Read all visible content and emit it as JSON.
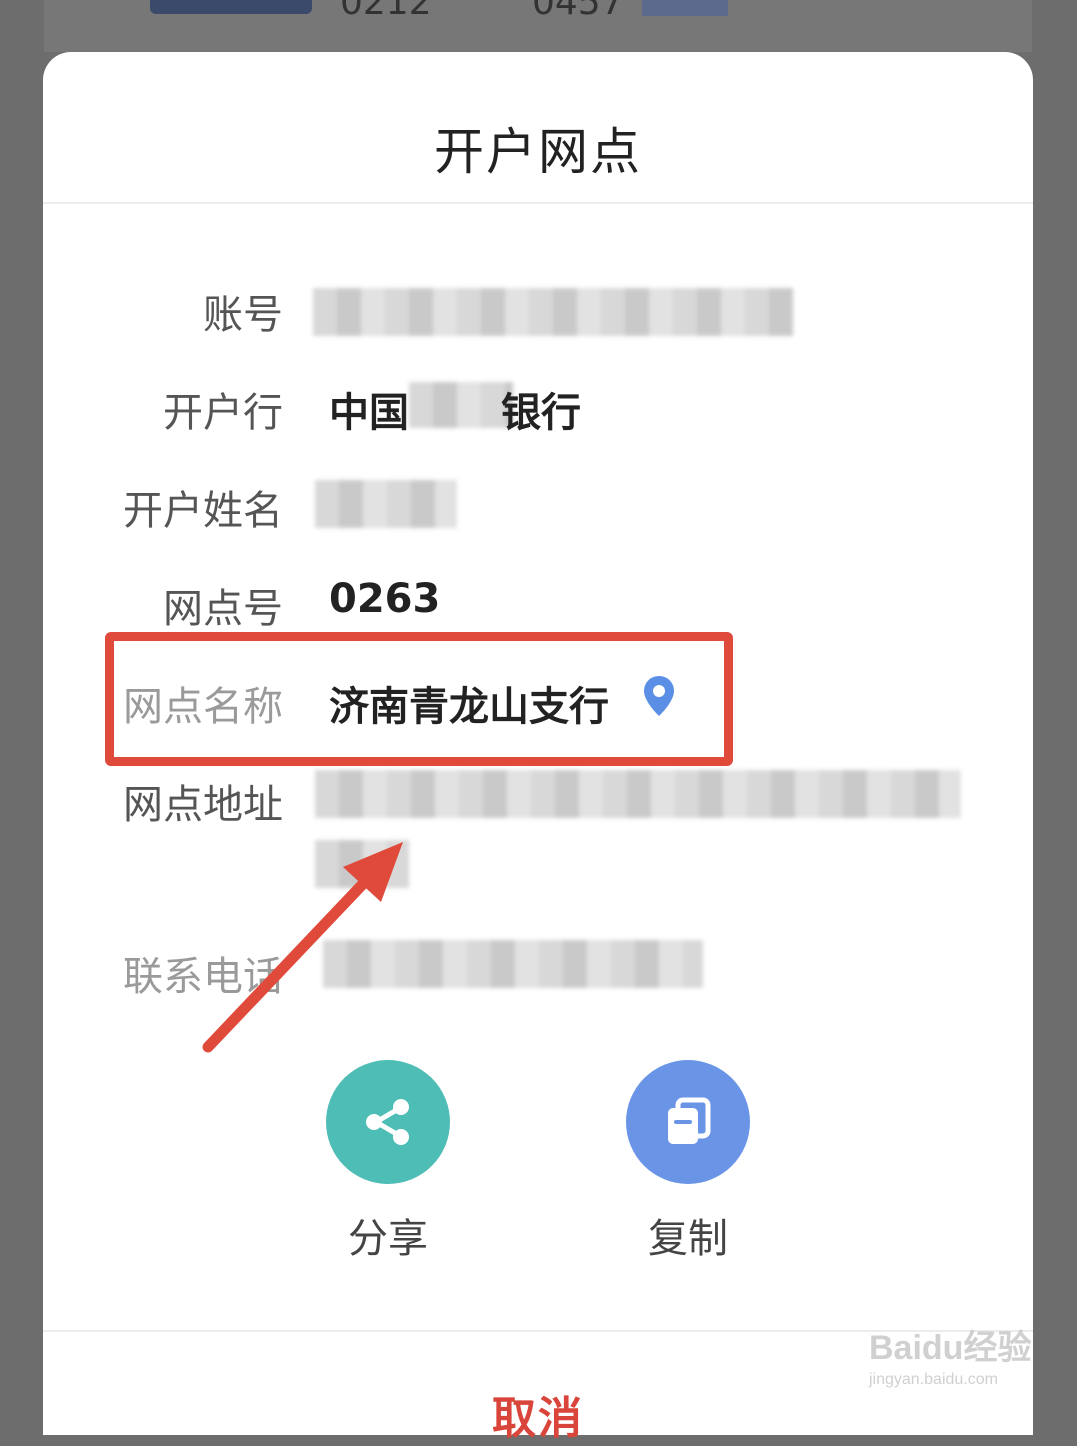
{
  "background": {
    "card_digits_left": "0212",
    "card_digits_right": "0457"
  },
  "sheet": {
    "title": "开户网点",
    "rows": [
      {
        "label": "账号",
        "value": ""
      },
      {
        "label": "开户行",
        "value_left": "中国",
        "value_right": "银行"
      },
      {
        "label": "开户姓名",
        "value": ""
      },
      {
        "label": "网点号",
        "value": "0263"
      },
      {
        "label": "网点名称",
        "value": "济南青龙山支行"
      },
      {
        "label": "网点地址",
        "value": ""
      },
      {
        "label": "联系电话",
        "value": ""
      }
    ],
    "actions": [
      {
        "label": "分享",
        "icon": "share-icon",
        "color": "#4dbdb5"
      },
      {
        "label": "复制",
        "icon": "copy-icon",
        "color": "#6a95e6"
      }
    ],
    "cancel_label": "取消"
  },
  "colors": {
    "highlight": "#e04a3b",
    "cancel": "#d9453a",
    "pin": "#5b8fe6"
  },
  "watermark": {
    "main": "Baidu经验",
    "sub": "jingyan.baidu.com"
  }
}
